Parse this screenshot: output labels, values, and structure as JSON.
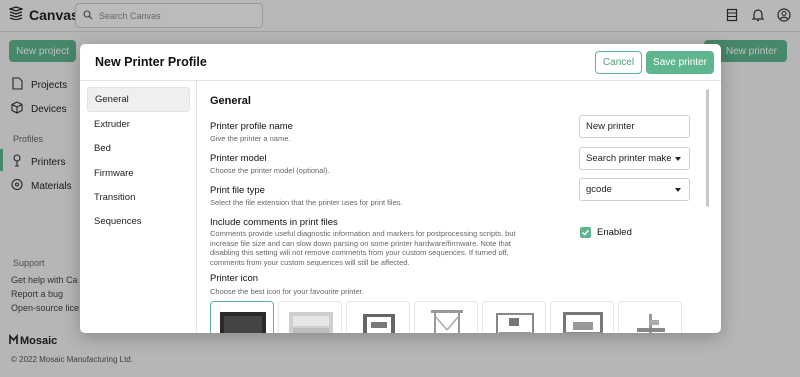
{
  "app": {
    "name": "Canvas",
    "search_placeholder": "Search Canvas"
  },
  "topbar_icons": [
    "book-icon",
    "bell-icon",
    "user-icon"
  ],
  "sidebar": {
    "new_project_label": "New project",
    "items": [
      {
        "label": "Projects",
        "icon": "file-icon"
      },
      {
        "label": "Devices",
        "icon": "cube-icon"
      }
    ],
    "profiles_heading": "Profiles",
    "profile_items": [
      {
        "label": "Printers",
        "icon": "printer-nozzle-icon",
        "active": true
      },
      {
        "label": "Materials",
        "icon": "spool-icon",
        "active": false
      }
    ],
    "support_heading": "Support",
    "support_links": [
      "Get help with Ca",
      "Report a bug",
      "Open-source lice"
    ],
    "brand_footer": "Mosaic",
    "copyright": "© 2022 Mosaic Manufacturing Ltd."
  },
  "page": {
    "new_printer_label": "New printer"
  },
  "modal": {
    "title": "New Printer Profile",
    "cancel_label": "Cancel",
    "save_label": "Save printer",
    "tabs": [
      "General",
      "Extruder",
      "Bed",
      "Firmware",
      "Transition",
      "Sequences"
    ],
    "active_tab": "General",
    "section_title": "General",
    "fields": {
      "name": {
        "label": "Printer profile name",
        "description": "Give the printer a name.",
        "value": "New printer"
      },
      "model": {
        "label": "Printer model",
        "description": "Choose the printer model (optional).",
        "value": "Search printer make"
      },
      "file_type": {
        "label": "Print file type",
        "description": "Select the file extension that the printer uses for print files.",
        "value": "gcode"
      },
      "comments": {
        "label": "Include comments in print files",
        "description_lines": [
          "Comments provide useful diagnostic information and markers for postprocessing scripts, but",
          "increase file size and can slow down parsing on some printer hardware/firmware. Note that",
          "disabling this setting will not remove comments from your custom sequences. If turned off,",
          "comments from your custom sequences will still be affected."
        ],
        "checkbox_label": "Enabled",
        "checked": true
      },
      "icon": {
        "label": "Printer icon",
        "description": "Choose the best icon for your favourite printer.",
        "options": [
          "boxed-printer-icon",
          "enclosed-printer-icon",
          "open-frame-printer-icon",
          "delta-printer-icon",
          "cartesian-printer-icon",
          "gantry-printer-icon",
          "bed-slinger-printer-icon"
        ],
        "selected_index": 0
      }
    }
  },
  "colors": {
    "accent": "#5fb58e",
    "accent_text": "#4a9e78"
  }
}
